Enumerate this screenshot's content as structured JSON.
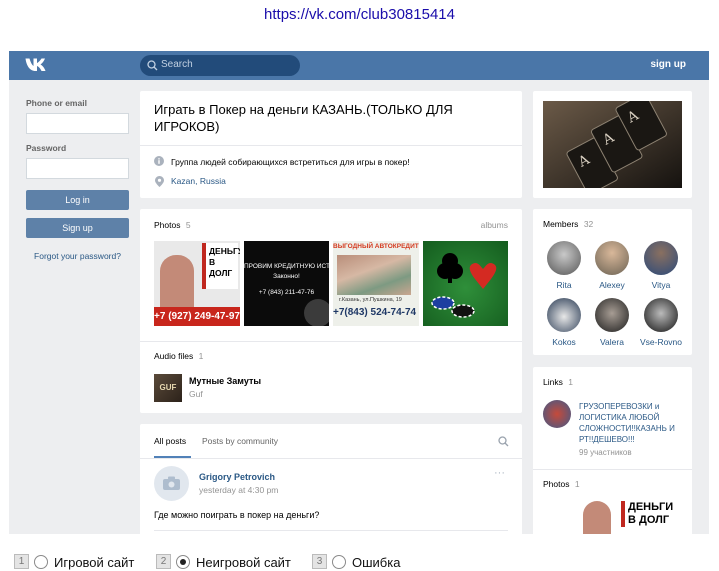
{
  "browser": {
    "url": "https://vk.com/club30815414"
  },
  "header": {
    "search_placeholder": "Search",
    "signup": "sign up"
  },
  "login": {
    "phone_label": "Phone or email",
    "password_label": "Password",
    "login_button": "Log in",
    "signup_button": "Sign up",
    "forgot": "Forgot your password?"
  },
  "group": {
    "title": "Играть в Покер на деньги КАЗАНЬ.(ТОЛЬКО ДЛЯ ИГРОКОВ)",
    "description": "Группа людей собирающихся встретиться для игры в покер!",
    "location": "Kazan, Russia"
  },
  "photos": {
    "label": "Photos",
    "count": "5",
    "albums": "albums",
    "items": [
      {
        "line1": "ДЕНЬГУ",
        "line2": "В ДОЛГ",
        "phone": "+7 (927) 249-47-97"
      },
      {
        "line1": "ПРОВИМ КРЕДИТНУЮ ИСТОРИ",
        "line2": "Законно!",
        "phone": "+7 (843) 211-47-76"
      },
      {
        "line1": "ВЫГОДНЫЙ АВТОКРЕДИТ",
        "line2": "г.Казань, ул.Пушкина, 19",
        "phone": "+7(843) 524-74-74"
      },
      {
        "line1": "",
        "line2": "",
        "phone": ""
      }
    ]
  },
  "audio": {
    "label": "Audio files",
    "count": "1",
    "title": "Мутные Замуты",
    "artist": "Guf",
    "cover_text": "GUF"
  },
  "posts": {
    "tab_all": "All posts",
    "tab_community": "Posts by community",
    "author": "Grigory Petrovich",
    "time": "yesterday at 4:30 pm",
    "text": "Где можно поиграть в покер на деньги?",
    "more": "···"
  },
  "members": {
    "label": "Members",
    "count": "32",
    "list": [
      "Rita",
      "Alexey",
      "Vitya",
      "Kokos",
      "Valera",
      "Vse-Rovno"
    ]
  },
  "links": {
    "label": "Links",
    "count": "1",
    "title": "ГРУЗОПЕРЕВОЗКИ и ЛОГИСТИКА ЛЮБОЙ СЛОЖНОСТИ!!КАЗАНЬ И РТ!!ДЕШЕВО!!!",
    "sub": "99 участников"
  },
  "side_photos": {
    "label": "Photos",
    "count": "1",
    "line1": "ДЕНЬГИ",
    "line2": "В ДОЛГ"
  },
  "footer": {
    "options": [
      {
        "num": "1",
        "label": "Игровой сайт",
        "selected": false
      },
      {
        "num": "2",
        "label": "Неигровой сайт",
        "selected": true
      },
      {
        "num": "3",
        "label": "Ошибка",
        "selected": false
      }
    ]
  },
  "colors": {
    "header": "#4a76a8",
    "button": "#5e81a8",
    "link": "#2a5885",
    "background": "#edeef0"
  }
}
